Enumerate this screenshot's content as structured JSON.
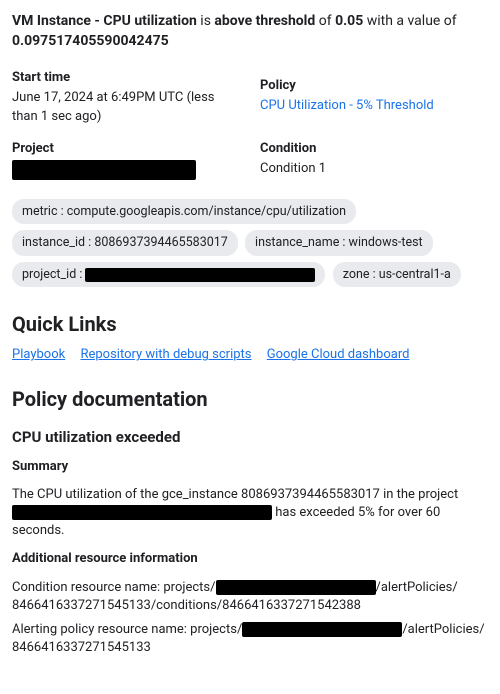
{
  "headline": {
    "pre": "VM Instance - CPU utilization",
    "mid1": " is ",
    "b1": "above threshold",
    "mid2": " of ",
    "b2": "0.05",
    "mid3": " with a value of ",
    "b3": "0.097517405590042475"
  },
  "info": {
    "start_label": "Start time",
    "start_value": "June 17, 2024 at 6:49PM UTC (less than 1 sec ago)",
    "policy_label": "Policy",
    "policy_link": "CPU Utilization - 5% Threshold",
    "project_label": "Project",
    "condition_label": "Condition",
    "condition_value": "Condition 1"
  },
  "chips": {
    "metric": "metric : compute.googleapis.com/instance/cpu/utilization",
    "instance_id": "instance_id : 8086937394465583017",
    "instance_name": "instance_name : windows-test",
    "project_prefix": "project_id : ",
    "zone": "zone : us-central1-a"
  },
  "quick": {
    "heading": "Quick Links",
    "playbook": "Playbook",
    "repo": "Repository with debug scripts",
    "dashboard": "Google Cloud dashboard"
  },
  "policydoc": {
    "heading": "Policy documentation",
    "sub": "CPU utilization exceeded",
    "summary_h": "Summary",
    "summary_pre": "The CPU utilization of the gce_instance 8086937394465583017 in the project ",
    "summary_post": " has exceeded 5% for over 60 seconds.",
    "addl_h": "Additional resource information",
    "cond_pre": "Condition resource name: projects/",
    "cond_mid": "/alertPolicies/",
    "cond_tail": "8466416337271545133/conditions/8466416337271542388",
    "pol_pre": "Alerting policy resource name: projects/",
    "pol_mid": "/alertPolicies/",
    "pol_tail": "8466416337271545133"
  }
}
